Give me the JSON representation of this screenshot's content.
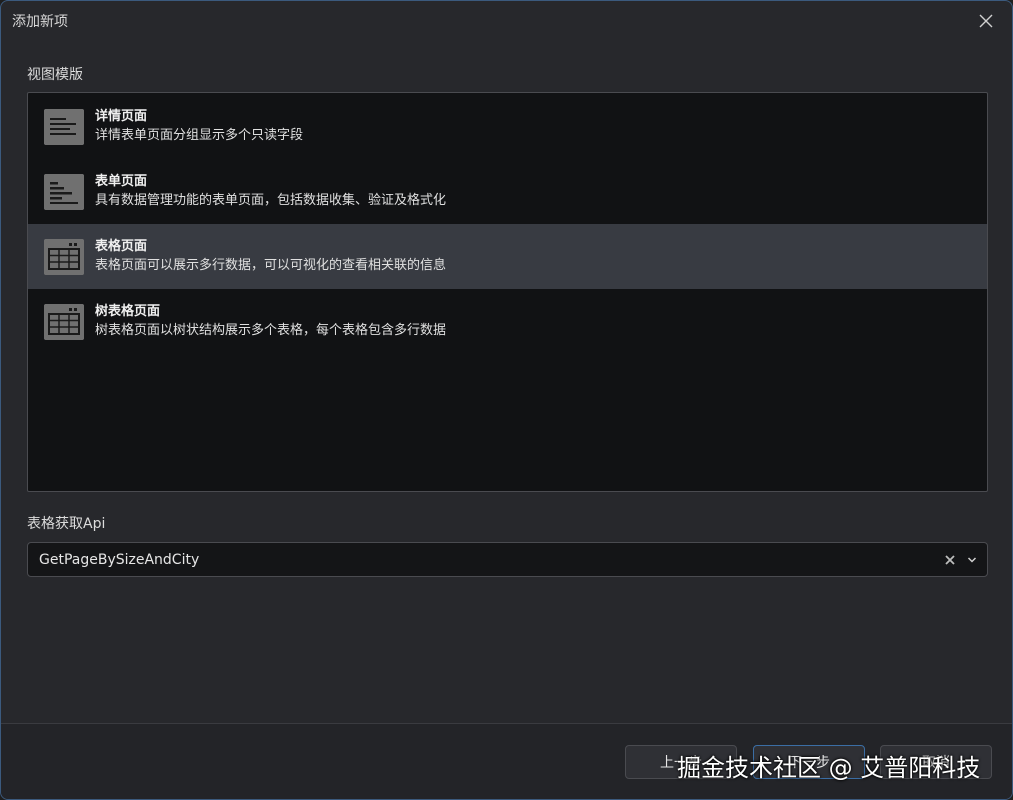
{
  "window": {
    "title": "添加新项",
    "close_icon": "close-icon"
  },
  "templates": {
    "label": "视图模版",
    "items": [
      {
        "title": "详情页面",
        "desc": "详情表单页面分组显示多个只读字段",
        "icon": "detail-page-icon",
        "selected": false
      },
      {
        "title": "表单页面",
        "desc": "具有数据管理功能的表单页面，包括数据收集、验证及格式化",
        "icon": "form-page-icon",
        "selected": false
      },
      {
        "title": "表格页面",
        "desc": "表格页面可以展示多行数据，可以可视化的查看相关联的信息",
        "icon": "table-page-icon",
        "selected": true
      },
      {
        "title": "树表格页面",
        "desc": "树表格页面以树状结构展示多个表格，每个表格包含多行数据",
        "icon": "tree-table-page-icon",
        "selected": false
      }
    ]
  },
  "api": {
    "label": "表格获取Api",
    "value": "GetPageBySizeAndCity"
  },
  "footer": {
    "prev_label": "上一步",
    "next_label": "下一步",
    "cancel_label": "取消"
  },
  "watermark": {
    "text": "掘金技术社区 @ 艾普阳科技"
  }
}
